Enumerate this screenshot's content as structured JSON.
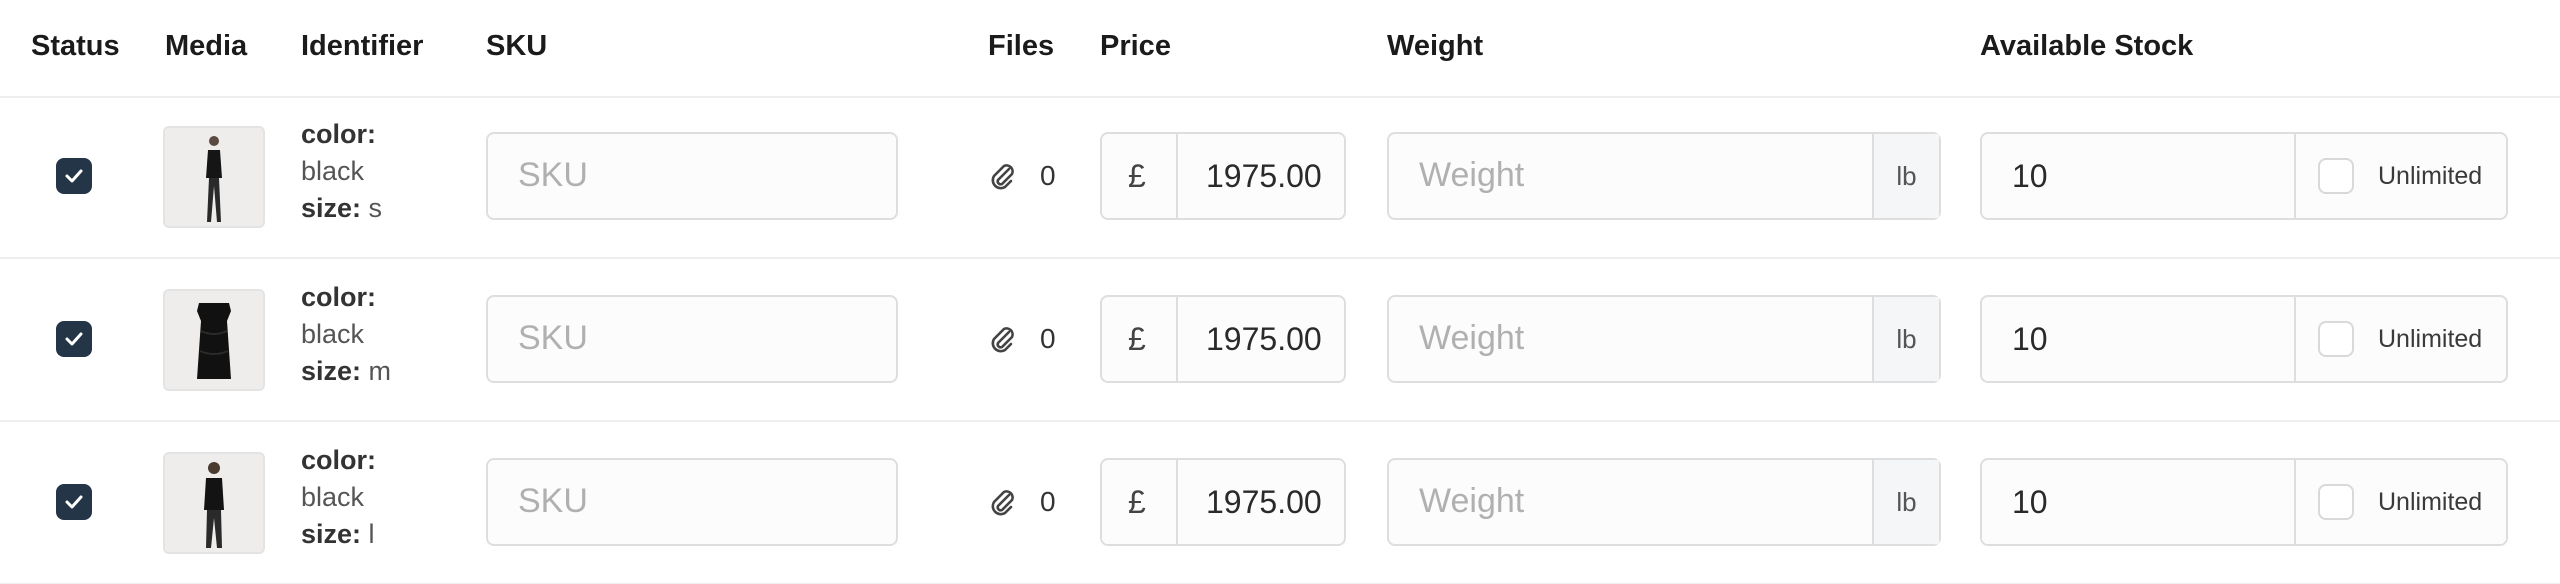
{
  "columns": {
    "status": "Status",
    "media": "Media",
    "identifier": "Identifier",
    "sku": "SKU",
    "files": "Files",
    "price": "Price",
    "weight": "Weight",
    "available_stock": "Available Stock"
  },
  "rows": [
    {
      "status_checked": true,
      "identifier": {
        "color_label": "color:",
        "color_value": "black",
        "size_label": "size:",
        "size_value": "s"
      },
      "sku_placeholder": "SKU",
      "files_count": "0",
      "currency": "£",
      "price": "1975.00",
      "weight_placeholder": "Weight",
      "weight_unit": "lb",
      "stock": "10",
      "unlimited_label": "Unlimited"
    },
    {
      "status_checked": true,
      "identifier": {
        "color_label": "color:",
        "color_value": "black",
        "size_label": "size:",
        "size_value": "m"
      },
      "sku_placeholder": "SKU",
      "files_count": "0",
      "currency": "£",
      "price": "1975.00",
      "weight_placeholder": "Weight",
      "weight_unit": "lb",
      "stock": "10",
      "unlimited_label": "Unlimited"
    },
    {
      "status_checked": true,
      "identifier": {
        "color_label": "color:",
        "color_value": "black",
        "size_label": "size:",
        "size_value": "l"
      },
      "sku_placeholder": "SKU",
      "files_count": "0",
      "currency": "£",
      "price": "1975.00",
      "weight_placeholder": "Weight",
      "weight_unit": "lb",
      "stock": "10",
      "unlimited_label": "Unlimited"
    }
  ],
  "icons": {
    "status": "checkmark-icon",
    "files": "paperclip-icon"
  },
  "colors": {
    "checkbox_fill": "#253548",
    "border": "#dedede",
    "placeholder": "#b0b0b0"
  }
}
